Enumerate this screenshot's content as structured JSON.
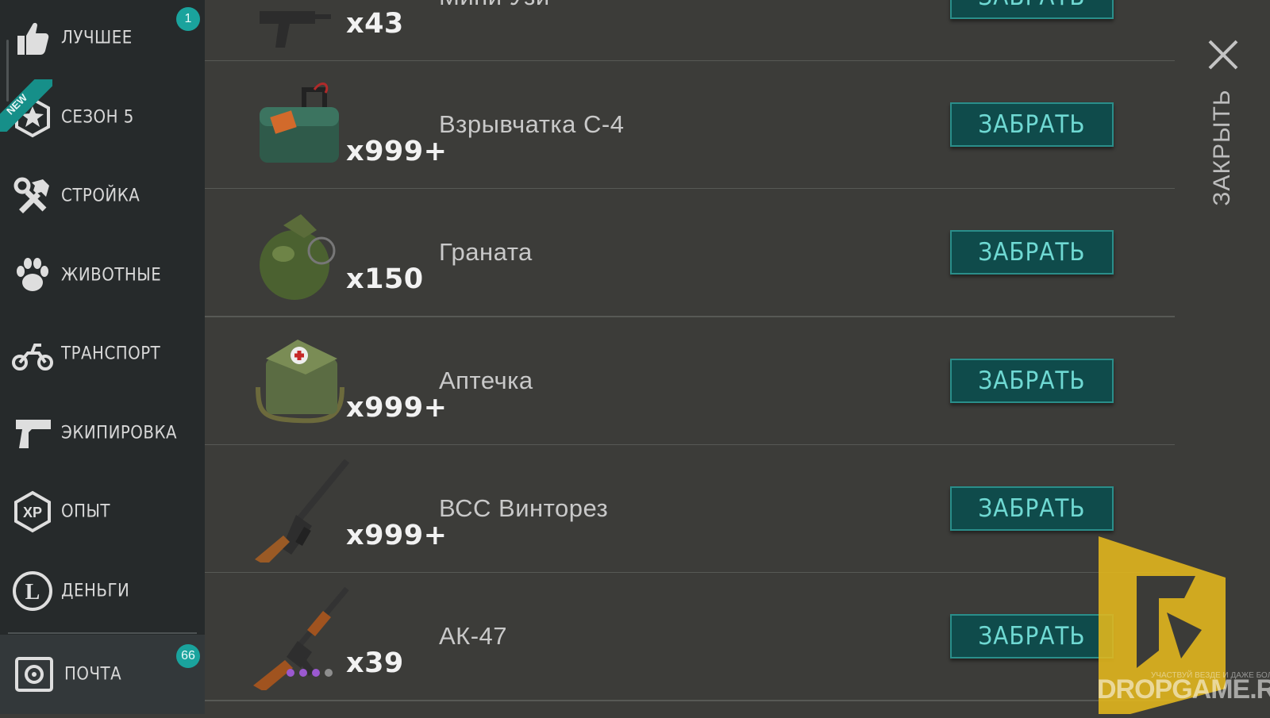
{
  "sidebar": {
    "items": [
      {
        "label": "ЛУЧШЕЕ",
        "icon": "thumbs-up-icon",
        "badge": "1"
      },
      {
        "label": "СЕЗОН 5",
        "icon": "season-star-badge-icon",
        "ribbon": "NEW"
      },
      {
        "label": "СТРОЙКА",
        "icon": "hammer-wrench-icon"
      },
      {
        "label": "ЖИВОТНЫЕ",
        "icon": "paw-icon"
      },
      {
        "label": "ТРАНСПОРТ",
        "icon": "motorcycle-icon"
      },
      {
        "label": "ЭКИПИРОВКА",
        "icon": "pistol-icon"
      },
      {
        "label": "ОПЫТ",
        "icon": "xp-icon"
      },
      {
        "label": "ДЕНЬГИ",
        "icon": "coin-icon"
      }
    ],
    "mail": {
      "label": "ПОЧТА",
      "icon": "mail-safe-icon",
      "badge": "66"
    }
  },
  "items": [
    {
      "name": "Мини Узи",
      "qty": "x43",
      "icon": "mini-uzi-icon"
    },
    {
      "name": "Взрывчатка С-4",
      "qty": "x999+",
      "icon": "c4-explosive-icon"
    },
    {
      "name": "Граната",
      "qty": "x150",
      "icon": "grenade-icon"
    },
    {
      "name": "Аптечка",
      "qty": "x999+",
      "icon": "medkit-icon"
    },
    {
      "name": "ВСС Винторез",
      "qty": "x999+",
      "icon": "vss-rifle-icon"
    },
    {
      "name": "АК-47",
      "qty": "x39",
      "icon": "ak47-icon",
      "rarity_dots": [
        "#9b59d0",
        "#9b59d0",
        "#9b59d0",
        "#8e8e8e"
      ]
    }
  ],
  "claim_label": "ЗАБРАТЬ",
  "close_label": "ЗАКРЫТЬ",
  "watermark": {
    "text": "DROPGAME.RU",
    "tagline": "УЧАСТВУЙ ВЕЗДЕ И ДАЖЕ БОЛЬШЕ"
  },
  "colors": {
    "accent": "#1aa39d",
    "button_text": "#6fd9d3",
    "button_bg": "#0f4b4b",
    "sidebar_bg": "#262a2b",
    "list_bg": "#3c3c39"
  }
}
